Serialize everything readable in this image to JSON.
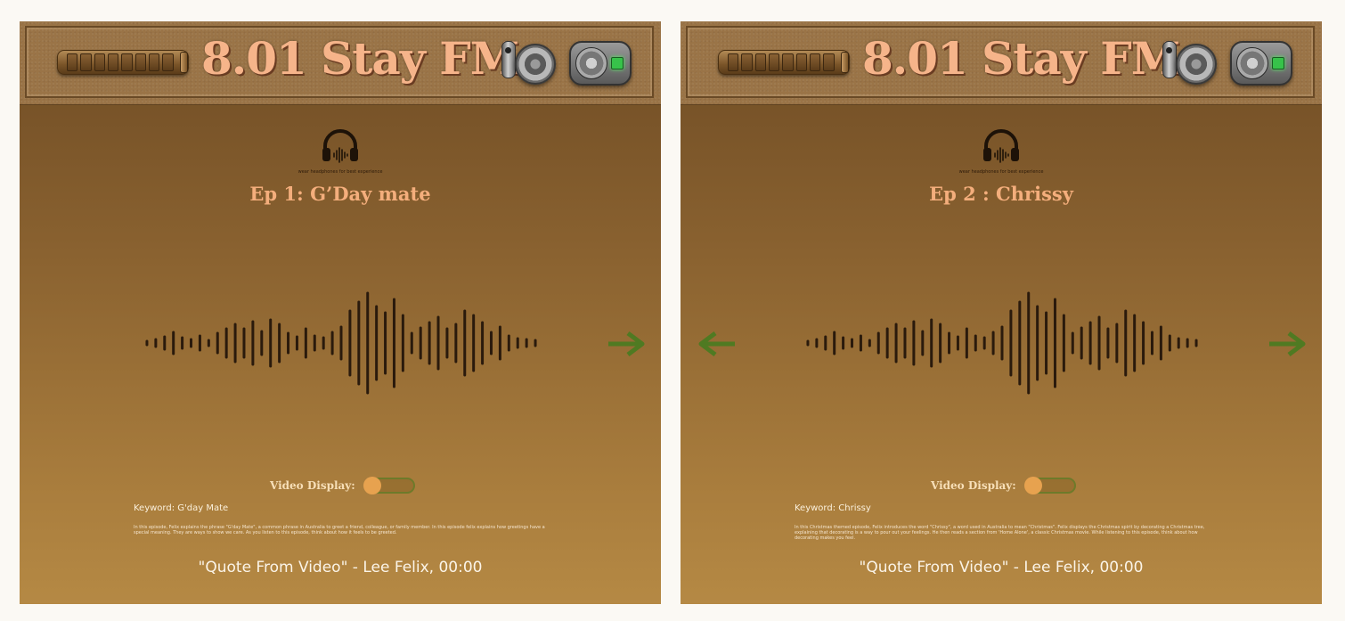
{
  "colors": {
    "title": "#f6b48a",
    "episode_title": "#f4ae7c",
    "arrow": "#4f7a22",
    "wave": "#2a1a0c",
    "toggle_thumb": "#e7a24f"
  },
  "icons": {
    "headphones": "headphones-icon",
    "next": "arrow-right-icon",
    "prev": "arrow-left-icon"
  },
  "panels": [
    {
      "station": "8.01 Stay FM",
      "tip": "wear headphones for best experience",
      "episode_title": "Ep 1: G’Day mate",
      "video_label": "Video Display:",
      "video_on": false,
      "keyword": "Keyword: G'day Mate",
      "description": "In this episode, Felix explains the phrase \"G'day Mate\", a common phrase in Australia to greet a friend, colleague, or family member. In this episode felix explains how greetings have a special meaning. They are ways to show we care. As you listen to this episode, think about how it feels to be greeted.",
      "quote": "\"Quote From Video\" - Lee Felix, 00:00"
    },
    {
      "station": "8.01 Stay FM",
      "tip": "wear headphones for best experience",
      "episode_title": "Ep 2 : Chrissy",
      "video_label": "Video Display:",
      "video_on": false,
      "keyword": "Keyword: Chrissy",
      "description": "In this Christmas themed episode, Felix introduces the word \"Chrissy\", a word used in Australia to mean \"Christmas\". Felix displays the Christmas spirit by decorating a Christmas tree, explaining that decorating is a way to pour out your feelings. He then reads a section from 'Home Alone', a classic Christmas movie. While listening to this episode, think about how decorating makes you feel.",
      "quote": "\"Quote From Video\" - Lee Felix, 00:00"
    }
  ]
}
